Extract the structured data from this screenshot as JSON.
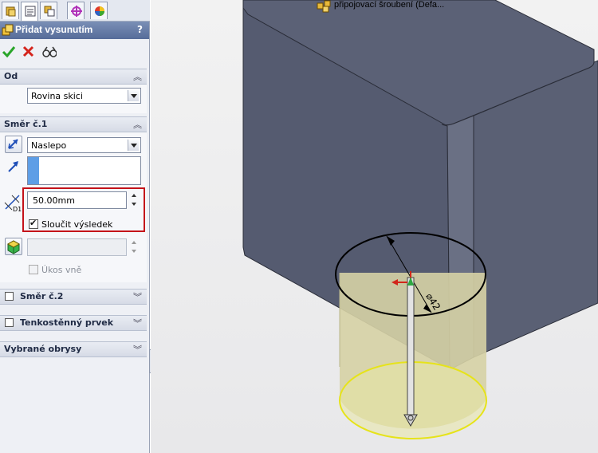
{
  "property_manager": {
    "title": "Přidat vysunutím",
    "help": "?",
    "tabs": [
      "feature-manager",
      "property-manager",
      "configuration-manager",
      "dimxpert-manager",
      "display-manager"
    ],
    "od": {
      "header": "Od",
      "start_condition": "Rovina skici"
    },
    "smer1": {
      "header": "Směr č.1",
      "end_condition": "Naslepo",
      "depth": "50.00mm",
      "merge_label": "Sloučit výsledek",
      "merge_checked": true,
      "draft_label": "Úkos vně",
      "draft_checked": false
    },
    "smer2": {
      "header": "Směr č.2",
      "checked": false
    },
    "thin": {
      "header": "Tenkostěnný prvek",
      "checked": false
    },
    "contours": {
      "header": "Vybrané obrysy"
    }
  },
  "viewport": {
    "tree_label": "připojovací šroubení  (Defa...",
    "dimension_label": "D1",
    "colors": {
      "body_dark": "#545a6e",
      "body_front": "#5d6377",
      "preview_fill": "#d7d3a8",
      "preview_edge": "#e3e21a"
    }
  }
}
